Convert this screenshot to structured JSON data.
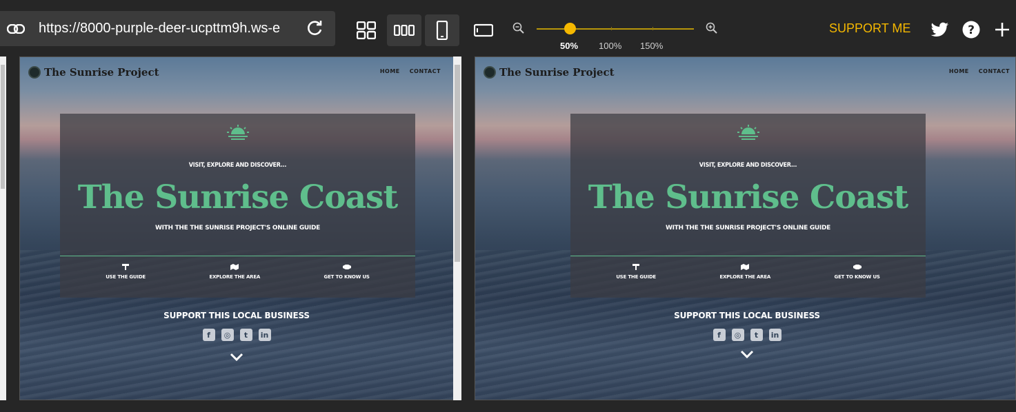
{
  "toolbar": {
    "url": "https://8000-purple-deer-ucpttm9h.ws-e",
    "zoom_labels": [
      "50%",
      "100%",
      "150%"
    ],
    "zoom_value_percent": 50,
    "support_label": "SUPPORT ME",
    "icons": [
      "link-icon",
      "reload-icon",
      "grid-view-icon",
      "columns-view-icon",
      "mobile-view-icon",
      "tablet-landscape-icon",
      "zoom-out-icon",
      "zoom-in-icon",
      "twitter-icon",
      "help-icon",
      "plus-icon"
    ],
    "accent_color": "#f5b800"
  },
  "site": {
    "logo_text": "The Sunrise Project",
    "nav": [
      "HOME",
      "CONTACT"
    ],
    "tagline_top": "VISIT, EXPLORE AND DISCOVER...",
    "hero_title": "The Sunrise Coast",
    "tagline_bottom": "WITH THE THE SUNRISE PROJECT'S ONLINE GUIDE",
    "links": [
      "USE THE GUIDE",
      "EXPLORE THE AREA",
      "GET TO KNOW US"
    ],
    "support_heading": "SUPPORT THIS LOCAL BUSINESS",
    "socials": [
      "f",
      "◎",
      "t",
      "in"
    ],
    "brand_color": "#5fbe8c"
  }
}
